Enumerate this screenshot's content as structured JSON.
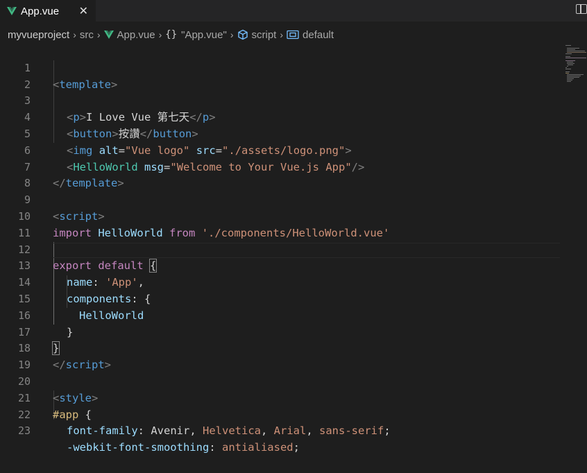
{
  "tab": {
    "label": "App.vue",
    "close": "✕"
  },
  "breadcrumb": {
    "project": "myvueproject",
    "folder": "src",
    "file": "App.vue",
    "section": "\"App.vue\"",
    "script": "script",
    "default": "default"
  },
  "line_numbers": [
    "1",
    "2",
    "3",
    "4",
    "5",
    "6",
    "7",
    "8",
    "9",
    "10",
    "11",
    "12",
    "13",
    "14",
    "15",
    "16",
    "17",
    "18",
    "19",
    "20",
    "21",
    "22",
    "23"
  ],
  "code": {
    "l1": {
      "open": "<",
      "tag": "template",
      "close": ">"
    },
    "l3": {
      "lt": "<",
      "p": "p",
      "gt": ">",
      "text": "I Love Vue 第七天",
      "endlt": "</",
      "endp": "p",
      "endgt": ">"
    },
    "l4": {
      "lt": "<",
      "tag": "button",
      "gt": ">",
      "text": "按讚",
      "endlt": "</",
      "endtag": "button",
      "endgt": ">"
    },
    "l5": {
      "lt": "<",
      "tag": "img",
      "attr1": "alt",
      "eq1": "=",
      "val1": "\"Vue logo\"",
      "attr2": "src",
      "eq2": "=",
      "val2": "\"./assets/logo.png\"",
      "gt": ">"
    },
    "l6": {
      "lt": "<",
      "tag": "HelloWorld",
      "attr": "msg",
      "eq": "=",
      "val": "\"Welcome to Your Vue.js App\"",
      "gt": "/>"
    },
    "l7": {
      "lt": "</",
      "tag": "template",
      "gt": ">"
    },
    "l9": {
      "lt": "<",
      "tag": "script",
      "gt": ">"
    },
    "l10": {
      "kw": "import",
      "name": "HelloWorld",
      "from": "from",
      "path": "'./components/HelloWorld.vue'"
    },
    "l12": {
      "kw1": "export",
      "kw2": "default",
      "brace": "{"
    },
    "l13": {
      "prop": "name",
      "colon": ": ",
      "val": "'App'",
      "comma": ","
    },
    "l14": {
      "prop": "components",
      "colon": ": ",
      "brace": "{"
    },
    "l15": {
      "name": "HelloWorld"
    },
    "l16": {
      "brace": "}"
    },
    "l17": {
      "brace": "}"
    },
    "l18": {
      "lt": "</",
      "tag": "script",
      "gt": ">"
    },
    "l20": {
      "lt": "<",
      "tag": "style",
      "gt": ">"
    },
    "l21": {
      "sel": "#app",
      "brace": " {"
    },
    "l22": {
      "prop": "font-family",
      "colon": ": ",
      "v1": "Avenir",
      "c1": ", ",
      "v2": "Helvetica",
      "c2": ", ",
      "v3": "Arial",
      "c3": ", ",
      "v4": "sans-serif",
      "semi": ";"
    },
    "l23": {
      "prop": "-webkit-font-smoothing",
      "colon": ": ",
      "val": "antialiased",
      "semi": ";"
    }
  }
}
